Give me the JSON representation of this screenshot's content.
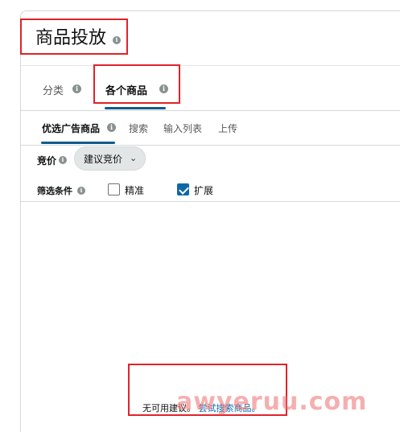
{
  "page": {
    "title": "商品投放"
  },
  "targeting_tabs": {
    "items": [
      {
        "label": "分类",
        "active": false
      },
      {
        "label": "各个商品",
        "active": true
      }
    ]
  },
  "source_tabs": {
    "items": [
      {
        "label": "优选广告商品",
        "active": true
      },
      {
        "label": "搜索",
        "active": false
      },
      {
        "label": "输入列表",
        "active": false
      },
      {
        "label": "上传",
        "active": false
      }
    ]
  },
  "bid": {
    "label": "竞价",
    "selected": "建议竞价"
  },
  "filters": {
    "label": "筛选条件",
    "exact": {
      "label": "精准",
      "checked": false
    },
    "expanded": {
      "label": "扩展",
      "checked": true
    }
  },
  "results": {
    "empty_text": "无可用建议。",
    "link_text": "尝试搜索商品。"
  },
  "watermark": {
    "text": "awyeruu.com"
  },
  "colors": {
    "accent": "#0f5c8c",
    "link": "#0f6cb0",
    "checkbox": "#0f67a8",
    "highlight": "#e0232a",
    "info_icon": "#8a9191"
  },
  "icons": {
    "info": "info-circle-icon",
    "dropdown": "chevron-down-icon",
    "check": "checkmark-icon"
  }
}
